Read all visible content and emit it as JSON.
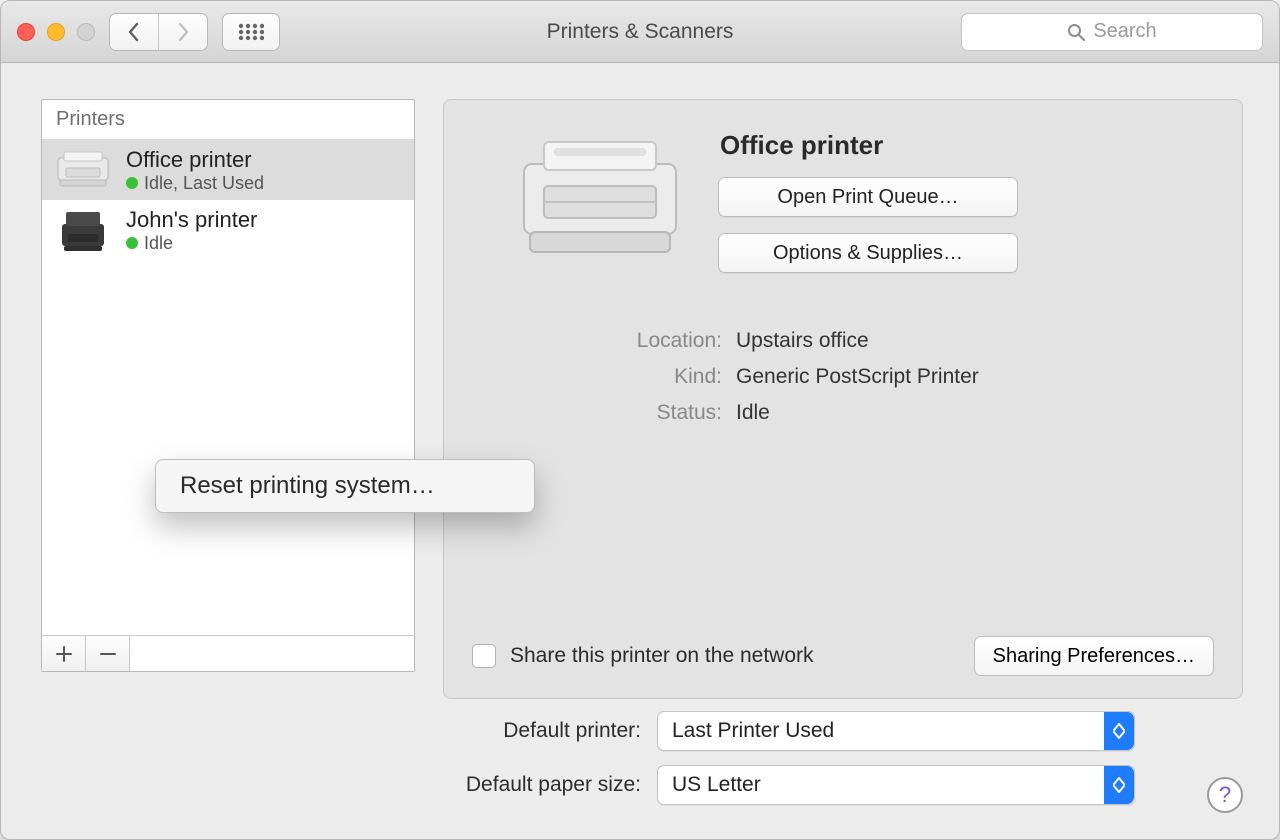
{
  "window": {
    "title": "Printers & Scanners"
  },
  "search": {
    "placeholder": "Search"
  },
  "sidebar": {
    "header": "Printers",
    "items": [
      {
        "name": "Office printer",
        "status": "Idle, Last Used",
        "selected": true
      },
      {
        "name": "John's printer",
        "status": "Idle",
        "selected": false
      }
    ]
  },
  "context_menu": {
    "reset_label": "Reset printing system…"
  },
  "detail": {
    "title": "Office printer",
    "open_queue_label": "Open Print Queue…",
    "options_supplies_label": "Options & Supplies…",
    "location_label": "Location:",
    "location_value": "Upstairs office",
    "kind_label": "Kind:",
    "kind_value": "Generic PostScript Printer",
    "status_label": "Status:",
    "status_value": "Idle",
    "share_label": "Share this printer on the network",
    "share_checked": false,
    "sharing_prefs_label": "Sharing Preferences…"
  },
  "bottom": {
    "default_printer_label": "Default printer:",
    "default_printer_value": "Last Printer Used",
    "default_paper_label": "Default paper size:",
    "default_paper_value": "US Letter"
  },
  "help_char": "?"
}
